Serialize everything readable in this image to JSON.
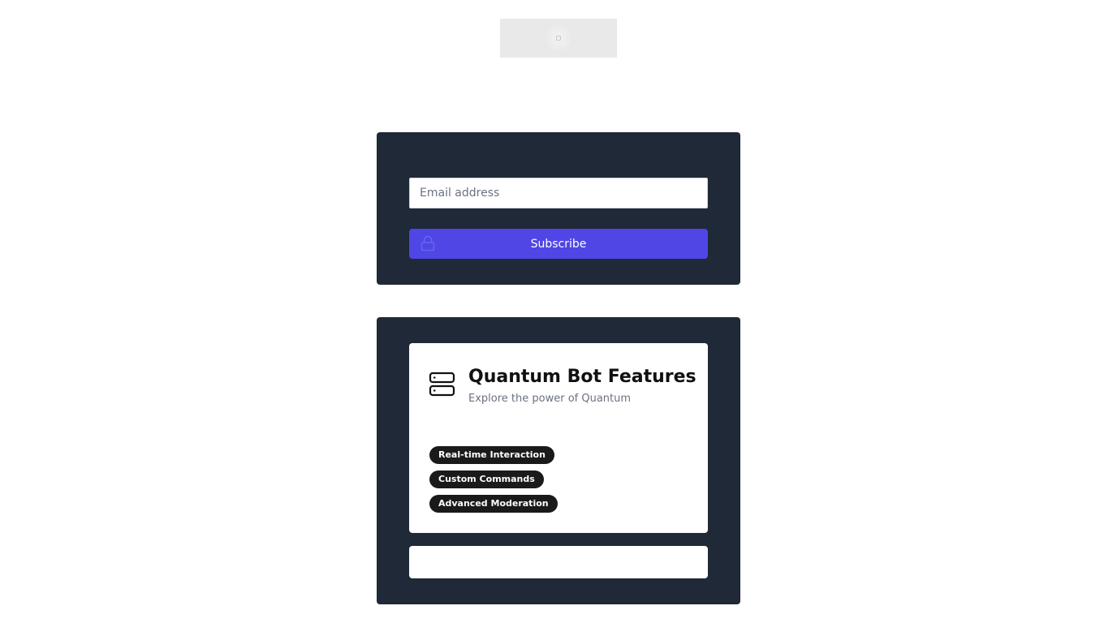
{
  "logo": {
    "icon": "logo-placeholder-icon"
  },
  "subscribe": {
    "email_placeholder": "Email address",
    "email_value": "",
    "button_label": "Subscribe",
    "button_icon": "lock-icon",
    "button_color": "#4f46e5"
  },
  "features": {
    "icon": "server-icon",
    "title": "Quantum Bot Features",
    "subtitle": "Explore the power of Quantum",
    "tags": [
      "Real-time Interaction",
      "Custom Commands",
      "Advanced Moderation"
    ]
  },
  "colors": {
    "card_background": "#1f2937",
    "tag_background": "#1a1a1a"
  }
}
